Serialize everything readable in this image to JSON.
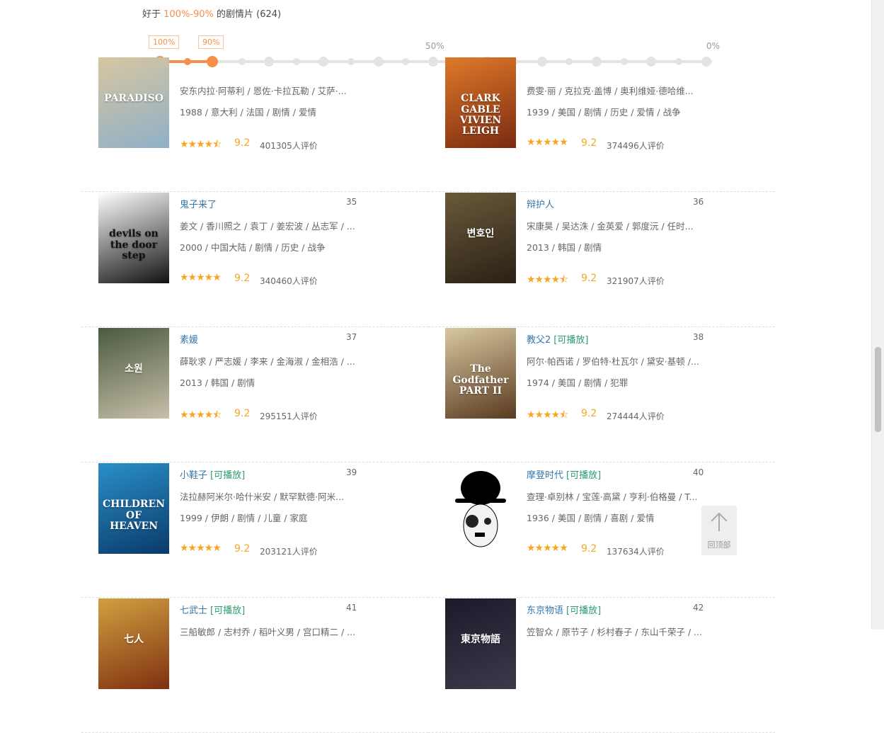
{
  "header": {
    "prefix": "好于 ",
    "range": "100%-90%",
    "suffix": " 的剧情片 (624)"
  },
  "slider": {
    "left_label": "100%",
    "right_label": "90%",
    "tick_50": "50%",
    "tick_0": "0%",
    "selected_from_pct": 100,
    "selected_to_pct": 90
  },
  "movies": [
    {
      "title": "",
      "playable": "",
      "rank": "",
      "cast": "安东内拉·阿蒂利 / 恩佐·卡拉瓦勒 / 艾萨·...",
      "info": "1988 / 意大利 / 法国 / 剧情 / 爱情",
      "score": "9.2",
      "votes": "401305人评价",
      "stars": 4.5,
      "poster_text": "PARADISO",
      "colors": [
        "#d7c6a0",
        "#8fb0c8"
      ]
    },
    {
      "title": "",
      "playable": "",
      "rank": "",
      "cast": "费雯·丽 / 克拉克·盖博 / 奥利维娅·德哈维...",
      "info": "1939 / 美国 / 剧情 / 历史 / 爱情 / 战争",
      "score": "9.2",
      "votes": "374496人评价",
      "stars": 5,
      "poster_text": "CLARK GABLE   VIVIEN LEIGH",
      "colors": [
        "#e07a2a",
        "#7a2a10"
      ]
    },
    {
      "title": "鬼子来了",
      "playable": "",
      "rank": "35",
      "cast": "姜文 / 香川照之 / 袁丁 / 姜宏波 / 丛志军 / ...",
      "info": "2000 / 中国大陆 / 剧情 / 历史 / 战争",
      "score": "9.2",
      "votes": "340460人评价",
      "stars": 5,
      "poster_text": "devils on the door step",
      "colors": [
        "#ffffff",
        "#111111"
      ]
    },
    {
      "title": "辩护人",
      "playable": "",
      "rank": "36",
      "cast": "宋康昊 / 吴达洙 / 金英爱 / 郭度沅 / 任时...",
      "info": "2013 / 韩国 / 剧情",
      "score": "9.2",
      "votes": "321907人评价",
      "stars": 4.5,
      "poster_text": "변호인",
      "colors": [
        "#6a5a3a",
        "#2a2015"
      ]
    },
    {
      "title": "素媛",
      "playable": "",
      "rank": "37",
      "cast": "薛耿求 / 严志媛 / 李来 / 金海淑 / 金相浩 / ...",
      "info": "2013 / 韩国 / 剧情",
      "score": "9.2",
      "votes": "295151人评价",
      "stars": 4.5,
      "poster_text": "소원",
      "colors": [
        "#4a5a40",
        "#c8c0a8"
      ]
    },
    {
      "title": "教父2",
      "playable": "[可播放]",
      "rank": "38",
      "cast": "阿尔·帕西诺 / 罗伯特·杜瓦尔 / 黛安·基顿 /...",
      "info": "1974 / 美国 / 剧情 / 犯罪",
      "score": "9.2",
      "votes": "274444人评价",
      "stars": 4.5,
      "poster_text": "The Godfather PART II",
      "colors": [
        "#d8c8a0",
        "#5a3a20"
      ]
    },
    {
      "title": "小鞋子",
      "playable": "[可播放]",
      "rank": "39",
      "cast": "法拉赫阿米尔·哈什米安 / 默罕默德·阿米...",
      "info": "1999 / 伊朗 / 剧情 / 儿童 / 家庭",
      "score": "9.2",
      "votes": "203121人评价",
      "stars": 5,
      "poster_text": "CHILDREN OF HEAVEN",
      "colors": [
        "#2a90c8",
        "#0a3a6a"
      ]
    },
    {
      "title": "摩登时代",
      "playable": "[可播放]",
      "rank": "40",
      "cast": "查理·卓别林 / 宝莲·高黛 / 亨利·伯格曼 / T...",
      "info": "1936 / 美国 / 剧情 / 喜剧 / 爱情",
      "score": "9.2",
      "votes": "137634人评价",
      "stars": 5,
      "poster_text": "",
      "colors": [
        "#ffffff",
        "#000000"
      ]
    },
    {
      "title": "七武士",
      "playable": "[可播放]",
      "rank": "41",
      "cast": "三船敏郎 / 志村乔 / 稻叶义男 / 宫口精二 / ...",
      "info": "",
      "score": "",
      "votes": "",
      "stars": 0,
      "poster_text": "七人",
      "colors": [
        "#d0a040",
        "#803010"
      ]
    },
    {
      "title": "东京物语",
      "playable": "[可播放]",
      "rank": "42",
      "cast": "笠智众 / 原节子 / 杉村春子 / 东山千荣子 / ...",
      "info": "",
      "score": "",
      "votes": "",
      "stars": 0,
      "poster_text": "東京物語",
      "colors": [
        "#1a1a2a",
        "#3a3a4a"
      ]
    }
  ],
  "back_to_top": {
    "label": "回顶部"
  }
}
